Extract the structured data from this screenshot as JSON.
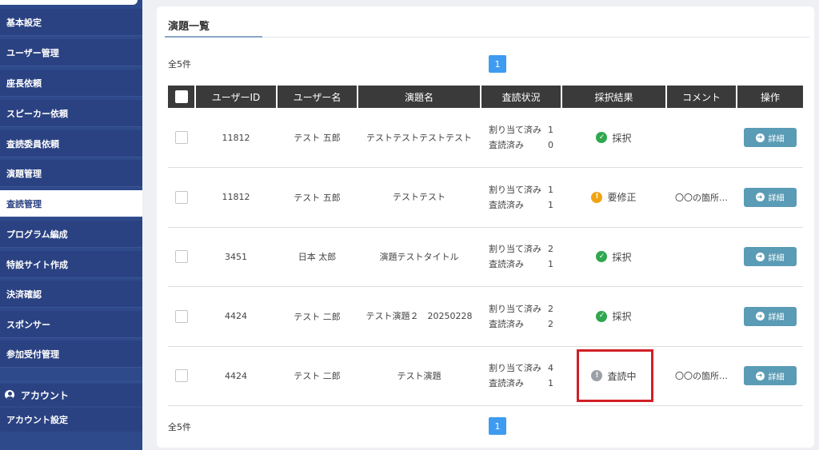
{
  "sidebar": {
    "items": [
      {
        "label": "基本設定"
      },
      {
        "label": "ユーザー管理"
      },
      {
        "label": "座長依頼"
      },
      {
        "label": "スピーカー依頼"
      },
      {
        "label": "査読委員依頼"
      },
      {
        "label": "演題管理"
      },
      {
        "label": "査読管理"
      },
      {
        "label": "プログラム編成"
      },
      {
        "label": "特設サイト作成"
      },
      {
        "label": "決済確認"
      },
      {
        "label": "スポンサー"
      },
      {
        "label": "参加受付管理"
      }
    ],
    "active": "査読管理",
    "account_header": "アカウント",
    "account_setting": "アカウント設定"
  },
  "main": {
    "title": "演題一覧",
    "total_label": "全5件",
    "current_page": "1",
    "table": {
      "headers": {
        "user_id": "ユーザーID",
        "user_name": "ユーザー名",
        "title": "演題名",
        "review_status": "査読状況",
        "result": "採択結果",
        "comment": "コメント",
        "action": "操作"
      },
      "review_labels": {
        "assigned": "割り当て済み",
        "reviewed": "査読済み"
      },
      "detail_label": "詳細",
      "rows": [
        {
          "user_id": "11812",
          "user_name": "テスト 五郎",
          "title": "テストテストテストテスト",
          "assigned": "1",
          "reviewed": "0",
          "result": "採択",
          "result_status": "accepted",
          "comment": ""
        },
        {
          "user_id": "11812",
          "user_name": "テスト 五郎",
          "title": "テストテスト",
          "assigned": "1",
          "reviewed": "1",
          "result": "要修正",
          "result_status": "revision",
          "comment": "〇〇の箇所…"
        },
        {
          "user_id": "3451",
          "user_name": "日本 太郎",
          "title": "演題テストタイトル",
          "assigned": "2",
          "reviewed": "1",
          "result": "採択",
          "result_status": "accepted",
          "comment": ""
        },
        {
          "user_id": "4424",
          "user_name": "テスト 二郎",
          "title": "テスト演題２　20250228",
          "assigned": "2",
          "reviewed": "2",
          "result": "採択",
          "result_status": "accepted",
          "comment": ""
        },
        {
          "user_id": "4424",
          "user_name": "テスト 二郎",
          "title": "テスト演題",
          "assigned": "4",
          "reviewed": "1",
          "result": "査読中",
          "result_status": "in-review",
          "comment": "〇〇の箇所…"
        }
      ]
    }
  },
  "colors": {
    "sidebar": "#2b4282",
    "accepted": "#2fa84f",
    "revision": "#f0a412",
    "in_review": "#9aa0a6",
    "detail_button": "#5a9bb5",
    "pagination": "#3e9bf0",
    "highlight": "#d21f26"
  }
}
